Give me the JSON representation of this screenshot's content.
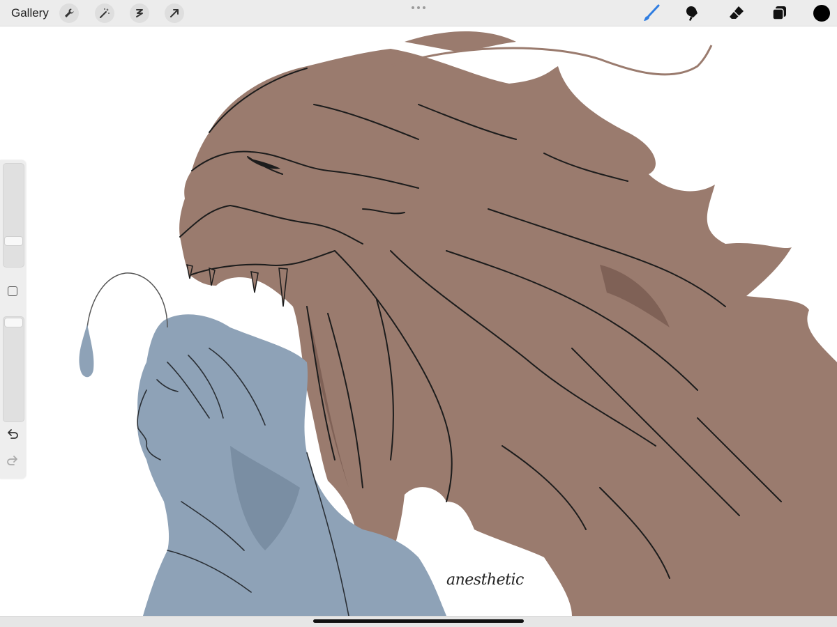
{
  "toolbar": {
    "gallery_label": "Gallery",
    "left_tools": [
      "wrench-icon",
      "magic-wand-icon",
      "selection-icon",
      "transform-arrow-icon"
    ],
    "right_tools": [
      "brush-icon",
      "smudge-icon",
      "eraser-icon",
      "layers-icon"
    ],
    "active_tool": "brush-icon",
    "accent_color": "#2f7de1",
    "current_color": "#000000"
  },
  "sidebar": {
    "size_slider_value": 0.78,
    "opacity_slider_value": 0.0,
    "undo_icon": "undo-icon",
    "redo_icon": "redo-icon"
  },
  "artwork": {
    "signature": "anesthetic",
    "colors": {
      "creature": "#9a7b6e",
      "creature_shadow": "#7f6156",
      "figure": "#8ea2b7",
      "figure_shadow": "#7a8ea3",
      "lineart": "#1c1c1c"
    }
  }
}
